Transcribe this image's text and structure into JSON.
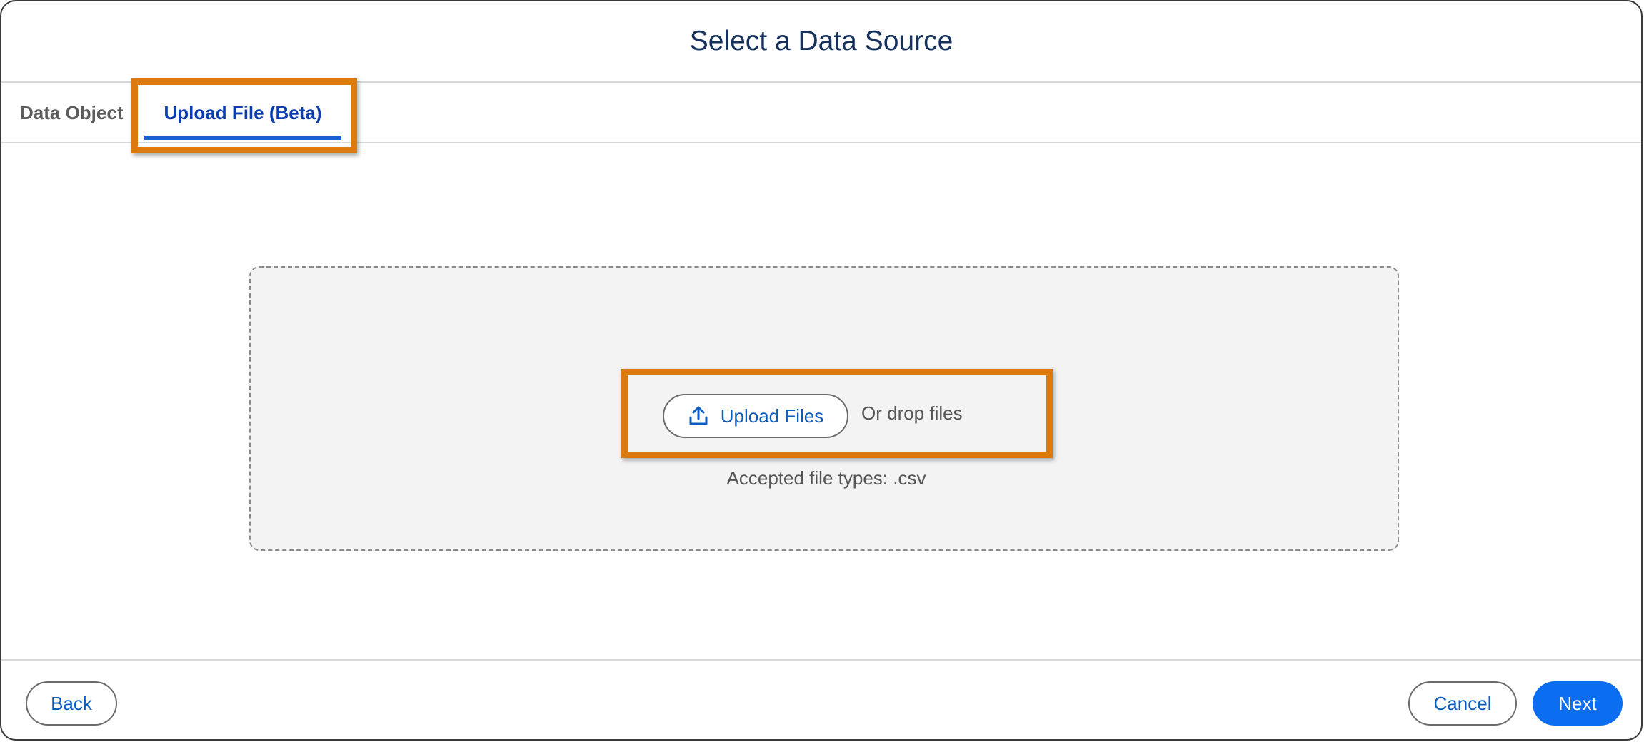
{
  "dialog": {
    "title": "Select a Data Source"
  },
  "tabs": [
    {
      "label": "Data Object",
      "active": false
    },
    {
      "label": "Upload File (Beta)",
      "active": true
    }
  ],
  "dropzone": {
    "upload_button_label": "Upload Files",
    "upload_icon": "upload-icon",
    "drop_text": "Or drop files",
    "accepted_types": "Accepted file types: .csv"
  },
  "footer": {
    "back_label": "Back",
    "cancel_label": "Cancel",
    "next_label": "Next"
  },
  "colors": {
    "accent": "#0b6ef0",
    "link": "#0b5cbf",
    "highlight": "#dd7a0e",
    "title": "#16325c"
  }
}
